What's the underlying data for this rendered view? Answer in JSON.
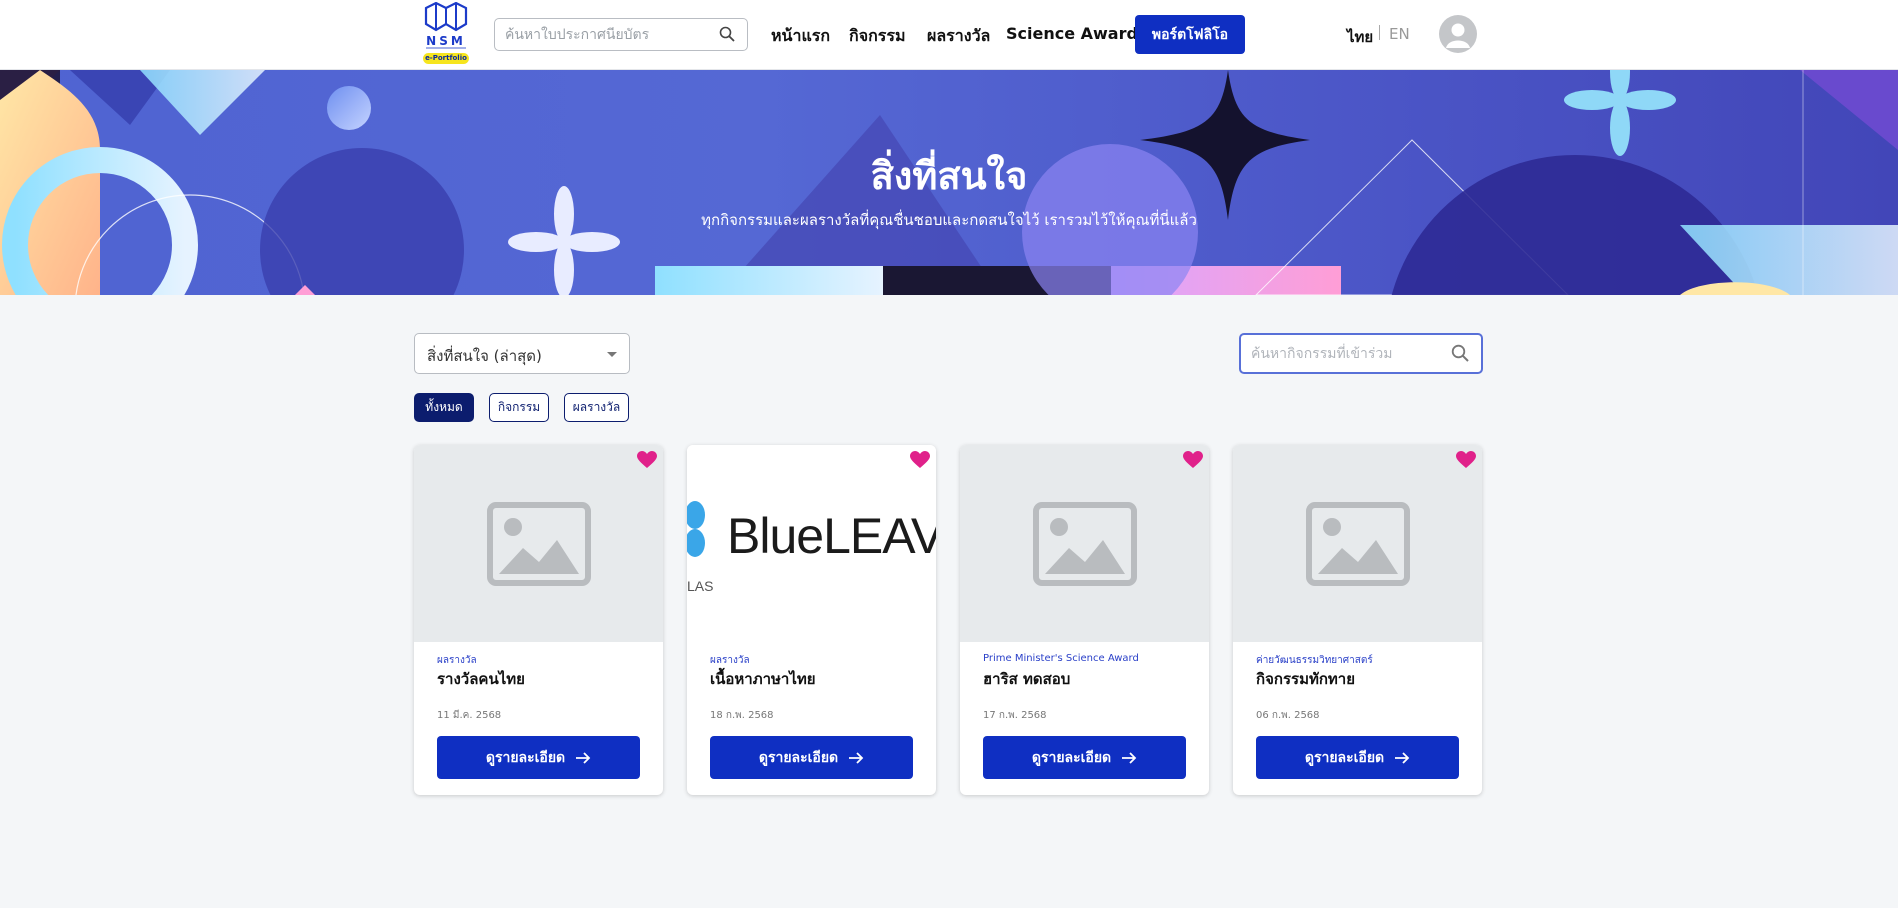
{
  "header": {
    "logo_text": "NSM",
    "logo_badge": "e-Portfolio",
    "search_placeholder": "ค้นหาใบประกาศนียบัตร",
    "nav": [
      "หน้าแรก",
      "กิจกรรม",
      "ผลรางวัล",
      "Science Award"
    ],
    "portfolio_label": "พอร์ตโฟลิโอ",
    "lang_th": "ไทย",
    "lang_en": "EN"
  },
  "banner": {
    "title": "สิ่งที่สนใจ",
    "subtitle": "ทุกกิจกรรมและผลรางวัลที่คุณชื่นชอบและกดสนใจไว้ เรารวมไว้ให้คุณที่นี่แล้ว"
  },
  "controls": {
    "sort_value": "สิ่งที่สนใจ (ล่าสุด)",
    "search_placeholder": "ค้นหากิจกรรมที่เข้าร่วม",
    "chips": [
      "ทั้งหมด",
      "กิจกรรม",
      "ผลรางวัล"
    ]
  },
  "cards": [
    {
      "category": "ผลรางวัล",
      "title": "รางวัลคนไทย",
      "date": "11 มี.ค. 2568",
      "button": "ดูรายละเอียด"
    },
    {
      "category": "ผลรางวัล",
      "title": "เนื้อหาภาษาไทย",
      "date": "18 ก.พ. 2568",
      "button": "ดูรายละเอียด",
      "image_text": "BlueLEAV",
      "image_subtext": "LAS"
    },
    {
      "category": "Prime Minister's Science Award",
      "title": "ฮาริส ทดสอบ",
      "date": "17 ก.พ. 2568",
      "button": "ดูรายละเอียด"
    },
    {
      "category": "ค่ายวัฒนธรรมวิทยาศาสตร์",
      "title": "กิจกรรมทักทาย",
      "date": "06 ก.พ. 2568",
      "button": "ดูรายละเอียด"
    }
  ],
  "colors": {
    "primary": "#0f2fc2",
    "navy": "#0c1d6e",
    "heart": "#e0218a",
    "banner": "#4f63d2"
  }
}
